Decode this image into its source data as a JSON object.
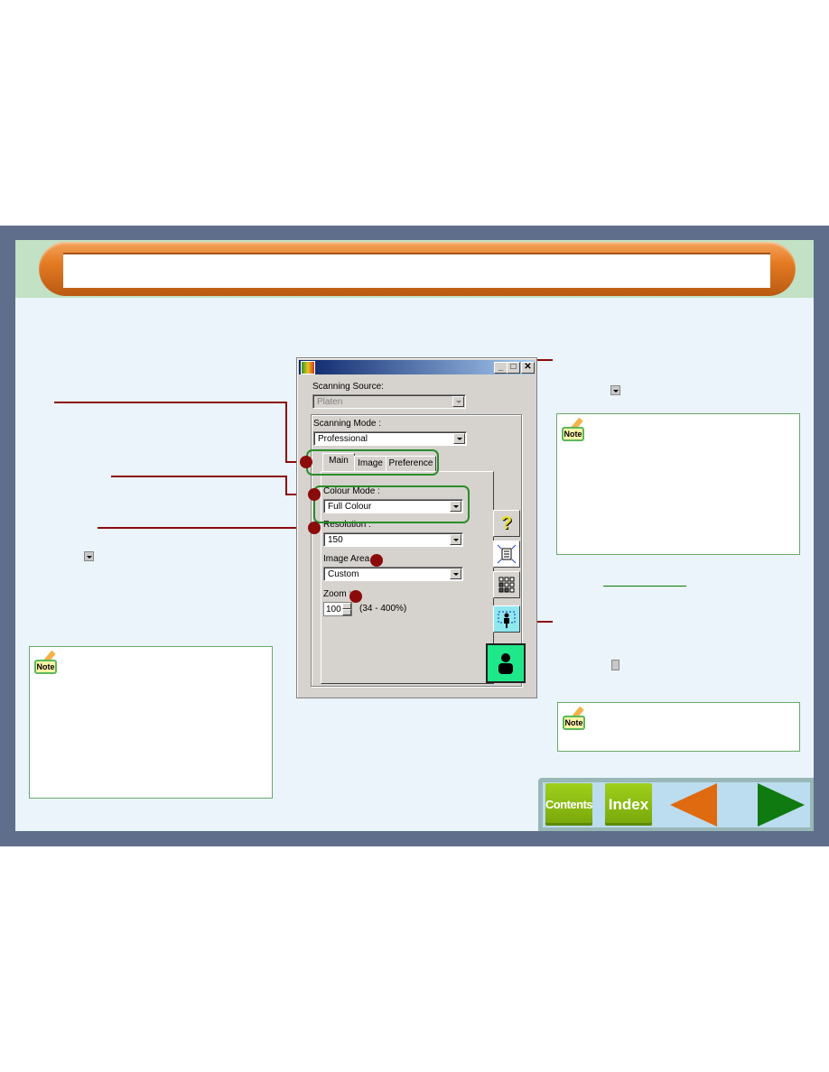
{
  "page": {
    "title": ""
  },
  "dialog": {
    "title": "",
    "window_buttons": {
      "minimize": "_",
      "maximize": "□",
      "close": "✕"
    },
    "scanning_source": {
      "label": "Scanning Source:",
      "value": "Platen",
      "enabled": false
    },
    "scanning_mode": {
      "label": "Scanning Mode :",
      "value": "Professional"
    },
    "tabs": [
      {
        "label": "Main",
        "active": true
      },
      {
        "label": "Image",
        "active": false
      },
      {
        "label": "Preference",
        "active": false
      }
    ],
    "colour_mode": {
      "label": "Colour Mode :",
      "value": "Full Colour"
    },
    "resolution": {
      "label": "Resolution :",
      "value": "150"
    },
    "image_area": {
      "label": "Image Area :",
      "value": "Custom"
    },
    "zoom": {
      "label": "Zoom :",
      "value": "100",
      "range": "(34 - 400%)"
    },
    "side_buttons": [
      {
        "icon": "help-icon",
        "glyph": "?"
      },
      {
        "icon": "auto-crop-icon",
        "glyph": ""
      },
      {
        "icon": "thumbnail-grid-icon",
        "glyph": ""
      },
      {
        "icon": "preview-icon",
        "glyph": ""
      },
      {
        "icon": "scan-icon",
        "glyph": ""
      }
    ]
  },
  "notes": [
    {
      "badge": "Note",
      "text": ""
    },
    {
      "badge": "Note",
      "text": ""
    },
    {
      "badge": "Note",
      "text": ""
    }
  ],
  "nav": {
    "contents": "Contents",
    "index": "Index",
    "prev_color": "#e06a10",
    "next_color": "#0f7a0f"
  },
  "colors": {
    "frame": "#5f6e8a",
    "page_bg": "#eaf4fa",
    "leader": "#8b0b0b",
    "highlight": "#2a8c2a",
    "title_orange": "#e47a22"
  }
}
